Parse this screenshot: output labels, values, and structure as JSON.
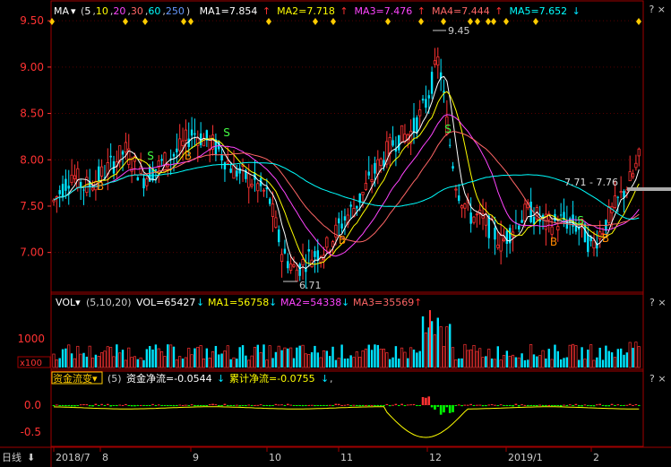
{
  "price_panel": {
    "indicator": "MA",
    "params": "(5,10,20,30,60,250)",
    "param_parts": [
      "5",
      "10",
      "20",
      "30",
      "60",
      "250"
    ],
    "param_colors": [
      "#ffffff",
      "#ffff00",
      "#ff44ff",
      "#ff6666",
      "#00ffff",
      "#6699ff"
    ],
    "ma_values": [
      {
        "label": "MA1=7.854",
        "arrow": "↑",
        "color": "#ffffff"
      },
      {
        "label": "MA2=7.718",
        "arrow": "↑",
        "color": "#ffff00"
      },
      {
        "label": "MA3=7.476",
        "arrow": "↑",
        "color": "#ff44ff"
      },
      {
        "label": "MA4=7.444",
        "arrow": "↑",
        "color": "#ff6666"
      },
      {
        "label": "MA5=7.652",
        "arrow": "↓",
        "color": "#00ffff"
      }
    ],
    "y_ticks": [
      "9.50",
      "9.00",
      "8.50",
      "8.00",
      "7.50",
      "7.00"
    ],
    "high_label": "9.45",
    "low_label": "6.71",
    "range_label": "7.71 - 7.76",
    "signals": {
      "buy": "B",
      "sell": "S"
    }
  },
  "vol_panel": {
    "indicator": "VOL",
    "params": "(5,10,20)",
    "vol_label": "VOL=65427",
    "vol_arrow": "↓",
    "ma1_label": "MA1=56758",
    "ma1_arrow": "↓",
    "ma2_label": "MA2=54338",
    "ma2_arrow": "↓",
    "ma3_label": "MA3=35569",
    "ma3_arrow": "↑",
    "y_tick": "1000",
    "unit": "x100",
    "help": "?",
    "close": "×"
  },
  "flow_panel": {
    "indicator": "资金流变",
    "params": "(5)",
    "net_label": "资金净流=-0.0544",
    "net_arrow": "↓",
    "cum_label": "累计净流=-0.0755",
    "cum_arrow": "↓",
    "sep": ",",
    "y_ticks": [
      "0.0",
      "-0.5"
    ],
    "help": "?",
    "close": "×"
  },
  "x_axis": {
    "period": "日线",
    "period_arrow": "⬇",
    "labels": [
      "2018/7",
      "8",
      "9",
      "10",
      "11",
      "12",
      "2019/1",
      "2"
    ]
  },
  "colors": {
    "up": "#ff3232",
    "down": "#00e4ff",
    "border": "#a00000",
    "axis_text": "#ff3232",
    "signal_marker": "#ffcc00"
  },
  "chart_data": {
    "type": "line",
    "title": "",
    "xlabel": "",
    "ylabel": "",
    "ylim": [
      6.6,
      9.55
    ],
    "x": [
      "2018/7",
      "8",
      "9",
      "10",
      "11",
      "12",
      "2019/1",
      "2"
    ],
    "series": [
      {
        "name": "MA1",
        "values": [
          7.6,
          7.9,
          8.2,
          7.5,
          7.2,
          9.0,
          7.4,
          7.85
        ]
      },
      {
        "name": "MA2",
        "values": [
          7.55,
          7.85,
          8.15,
          7.6,
          7.3,
          8.8,
          7.45,
          7.72
        ]
      },
      {
        "name": "MA3",
        "values": [
          7.5,
          7.8,
          8.1,
          7.7,
          7.4,
          8.4,
          7.5,
          7.48
        ]
      },
      {
        "name": "MA4",
        "values": [
          7.5,
          7.75,
          8.05,
          7.8,
          7.5,
          8.2,
          7.5,
          7.44
        ]
      },
      {
        "name": "MA5",
        "values": [
          7.8,
          7.85,
          7.95,
          7.9,
          7.75,
          7.85,
          7.75,
          7.65
        ]
      }
    ]
  }
}
